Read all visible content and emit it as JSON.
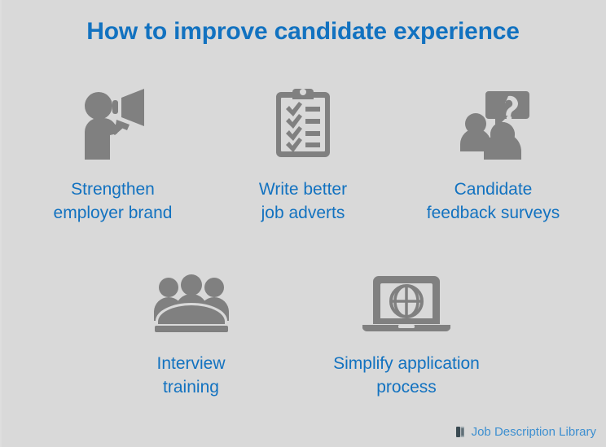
{
  "slide": {
    "title": "How to improve candidate experience",
    "background_color": "#d9d9d9",
    "accent_color": "#1272c0",
    "icon_color": "#808080"
  },
  "items": [
    {
      "label_line1": "Strengthen",
      "label_line2": "employer brand",
      "icon": "person-megaphone-icon"
    },
    {
      "label_line1": "Write better",
      "label_line2": "job adverts",
      "icon": "clipboard-checklist-icon"
    },
    {
      "label_line1": "Candidate",
      "label_line2": "feedback surveys",
      "icon": "people-question-bubble-icon"
    },
    {
      "label_line1": "Interview",
      "label_line2": "training",
      "icon": "people-panel-icon"
    },
    {
      "label_line1": "Simplify application",
      "label_line2": "process",
      "icon": "laptop-globe-icon"
    }
  ],
  "footer": {
    "brand": "Job Description Library",
    "icon": "books-library-icon",
    "color": "#3d8fd0"
  }
}
